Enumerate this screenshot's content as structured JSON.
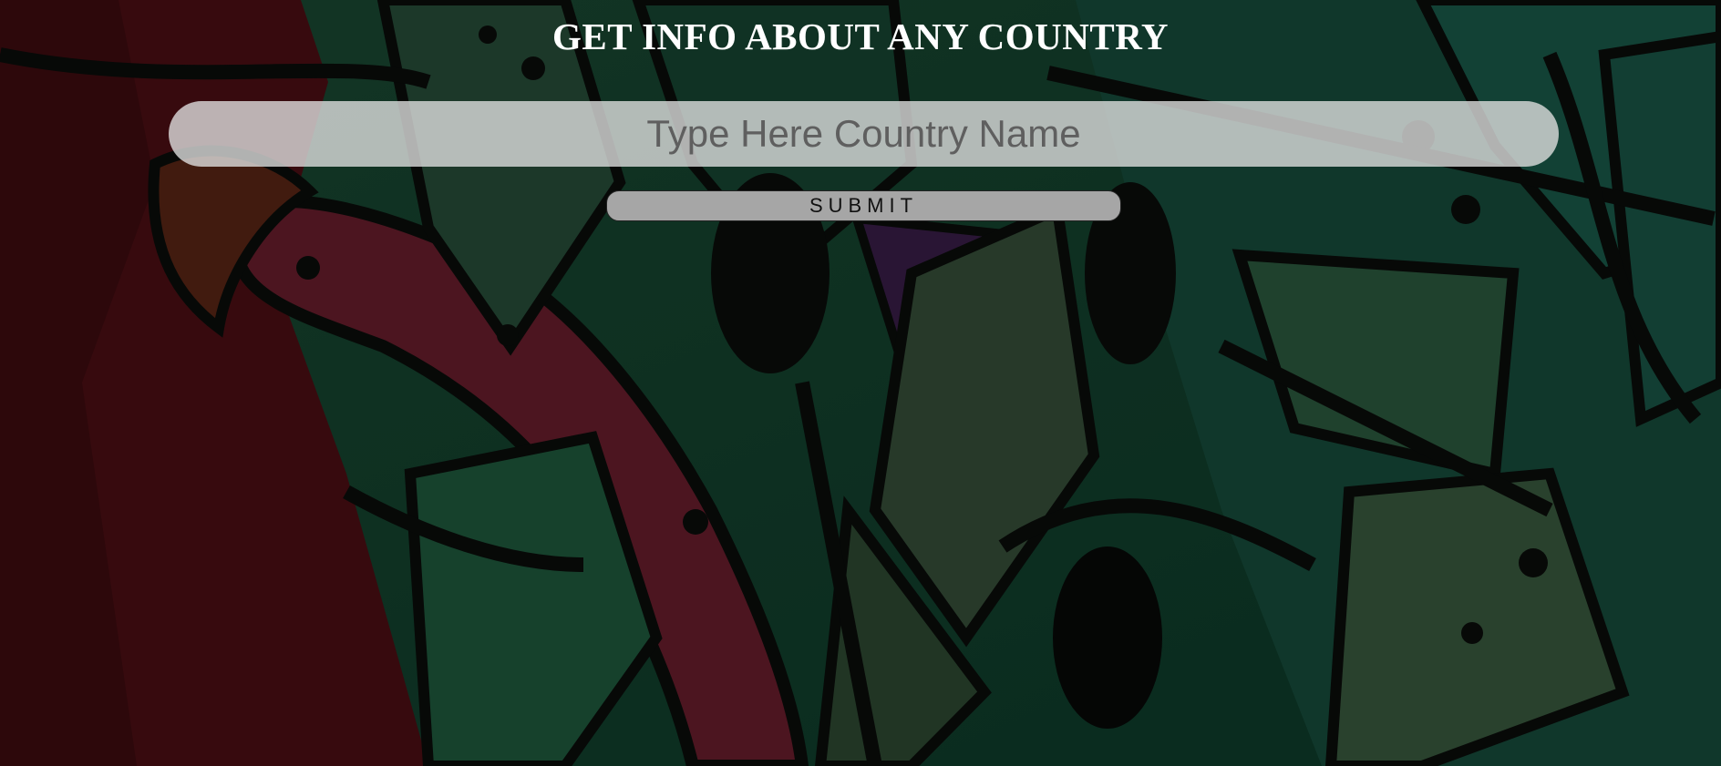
{
  "page": {
    "title": "GET INFO ABOUT ANY COUNTRY"
  },
  "search": {
    "placeholder": "Type Here Country Name",
    "value": ""
  },
  "submit": {
    "label": "SUBMIT"
  },
  "colors": {
    "title": "#ffffff",
    "input_background": "#e1e1e1",
    "button_background": "#a6a6a6",
    "button_text": "#111111"
  }
}
